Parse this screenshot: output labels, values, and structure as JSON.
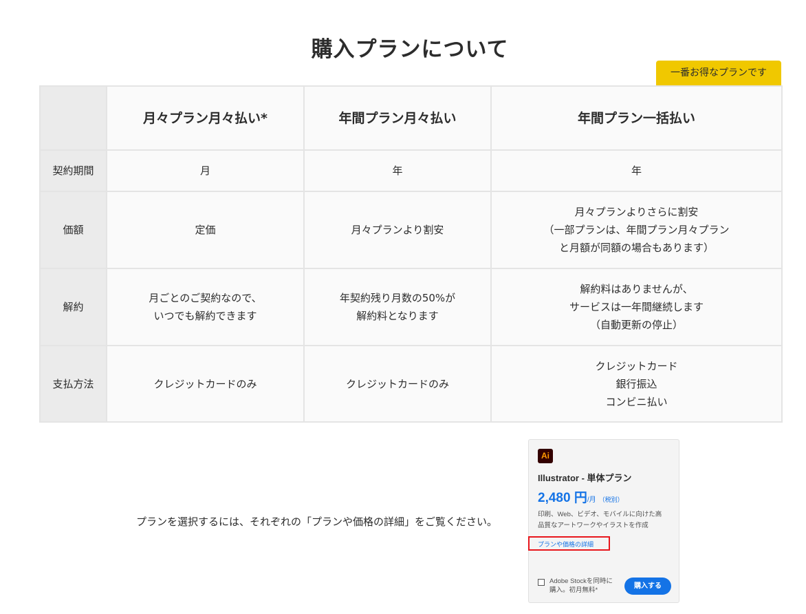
{
  "page": {
    "title": "購入プランについて",
    "best_badge": "一番お得なプランです"
  },
  "table": {
    "headers": [
      "月々プラン月々払い*",
      "年間プラン月々払い",
      "年間プラン一括払い"
    ],
    "rows": [
      {
        "label": "契約期間",
        "cells": [
          [
            "月"
          ],
          [
            "年"
          ],
          [
            "年"
          ]
        ]
      },
      {
        "label": "価額",
        "cells": [
          [
            "定価"
          ],
          [
            "月々プランより割安"
          ],
          [
            "月々プランよりさらに割安",
            "（一部プランは、年間プラン月々プラン",
            "と月額が同額の場合もあります）"
          ]
        ]
      },
      {
        "label": "解約",
        "cells": [
          [
            "月ごとのご契約なので、",
            "いつでも解約できます"
          ],
          [
            "年契約残り月数の50%が",
            "解約料となります"
          ],
          [
            "解約料はありませんが、",
            "サービスは一年間継続します",
            "（自動更新の停止）"
          ]
        ]
      },
      {
        "label": "支払方法",
        "cells": [
          [
            "クレジットカードのみ"
          ],
          [
            "クレジットカードのみ"
          ],
          [
            "クレジットカード",
            "銀行振込",
            "コンビニ払い"
          ]
        ]
      }
    ]
  },
  "instruction": "プランを選択するには、それぞれの「プランや価格の詳細」をご覧ください。",
  "card": {
    "logo": "Ai",
    "title": "Illustrator - 単体プラン",
    "price": "2,480 円",
    "per": "/月",
    "tax": "（税別）",
    "desc_line1": "印刷、Web、ビデオ、モバイルに向けた高",
    "desc_line2": "品質なアートワークやイラストを作成",
    "details_link": "プランや価格の詳細",
    "stock_line1": "Adobe Stockを同時に",
    "stock_line2": "購入。初月無料*",
    "buy_label": "購入する"
  },
  "colors": {
    "badge": "#f0c800",
    "link": "#1473e6",
    "highlight": "#e8161c",
    "ai_bg": "#330000",
    "ai_text": "#ff9a00"
  }
}
